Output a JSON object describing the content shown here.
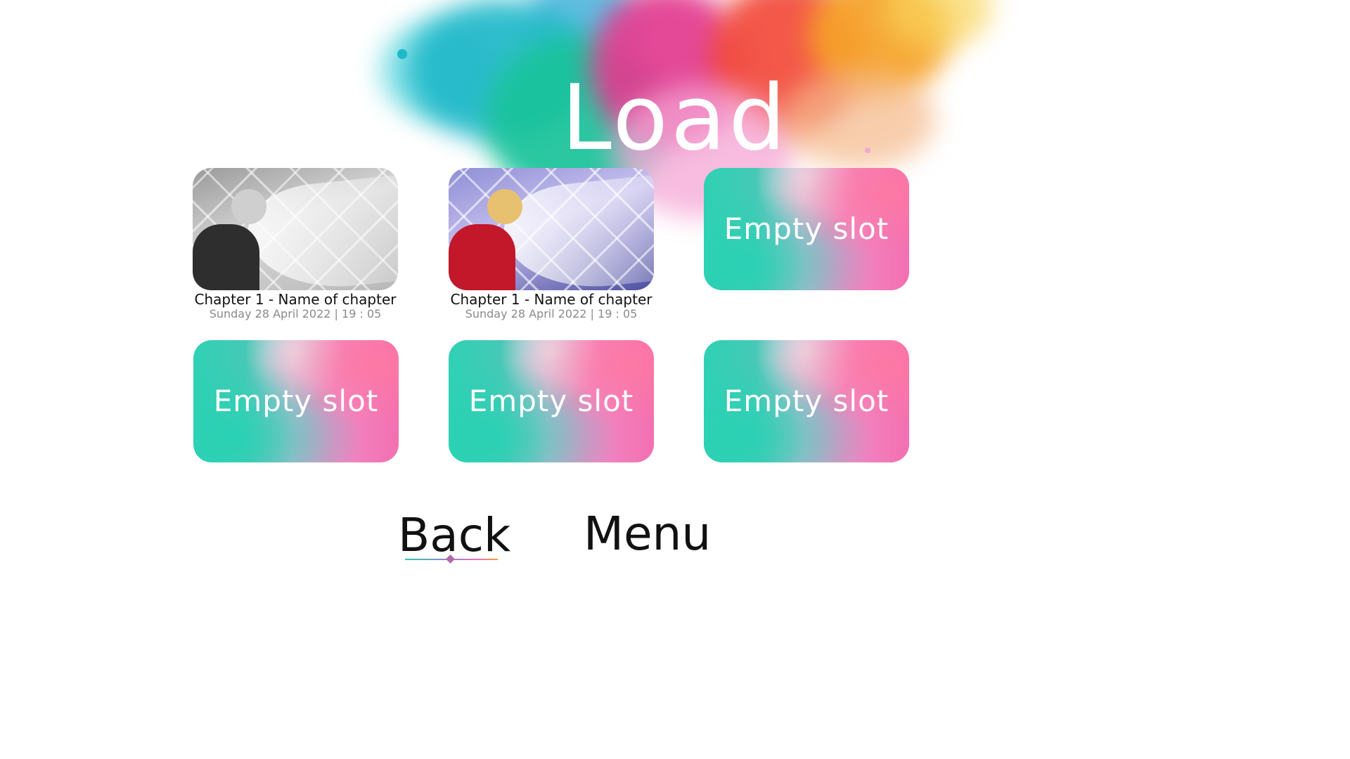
{
  "screen": {
    "title": "Load"
  },
  "slots": [
    {
      "state": "filled",
      "thumbnail": "grayscale",
      "title": "Chapter 1 - Name of chapter",
      "date": "Sunday 28 April 2022 | 19 : 05"
    },
    {
      "state": "filled",
      "thumbnail": "color",
      "title": "Chapter 1 - Name of chapter",
      "date": "Sunday 28 April 2022 | 19 : 05"
    },
    {
      "state": "empty",
      "label": "Empty slot"
    },
    {
      "state": "empty",
      "label": "Empty slot"
    },
    {
      "state": "empty",
      "label": "Empty slot"
    },
    {
      "state": "empty",
      "label": "Empty slot"
    }
  ],
  "nav": {
    "back_label": "Back",
    "menu_label": "Menu",
    "selected": "Back"
  },
  "colors": {
    "accent_teal": "#2fd1b4",
    "accent_pink": "#f36fb1",
    "text": "#111111",
    "date_text": "#8a8a8a"
  }
}
